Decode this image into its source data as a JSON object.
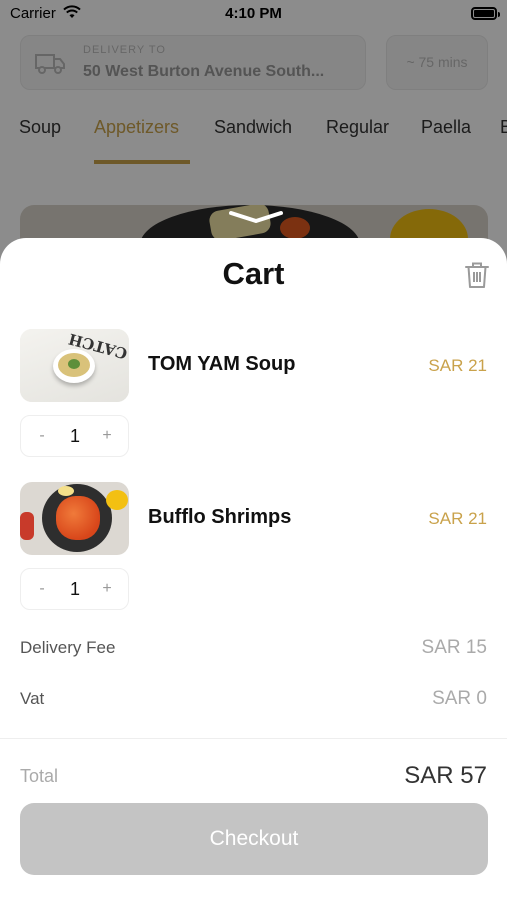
{
  "status_bar": {
    "carrier": "Carrier",
    "time": "4:10 PM"
  },
  "header": {
    "delivery_label": "DELIVERY TO",
    "delivery_address": "50 West Burton Avenue South...",
    "eta": "~ 75 mins"
  },
  "category_tabs": [
    {
      "label": "Soup",
      "active": false
    },
    {
      "label": "Appetizers",
      "active": true
    },
    {
      "label": "Sandwich",
      "active": false
    },
    {
      "label": "Regular",
      "active": false
    },
    {
      "label": "Paella",
      "active": false
    },
    {
      "label": "B",
      "active": false
    }
  ],
  "cart": {
    "title": "Cart",
    "items": [
      {
        "name": "TOM YAM Soup",
        "price": "SAR 21",
        "quantity": "1",
        "minus": "-",
        "plus": "+"
      },
      {
        "name": "Bufflo Shrimps",
        "price": "SAR 21",
        "quantity": "1",
        "minus": "-",
        "plus": "+"
      }
    ],
    "delivery_fee": {
      "label": "Delivery Fee",
      "value": "SAR 15"
    },
    "vat": {
      "label": "Vat",
      "value": "SAR 0"
    },
    "total": {
      "label": "Total",
      "value": "SAR 57"
    },
    "checkout_label": "Checkout",
    "photo_text": "CATCH"
  },
  "colors": {
    "accent": "#c9a24b",
    "checkout_disabled": "#c4c4c4",
    "overlay": "rgba(0,0,0,0.45)"
  },
  "icons": {
    "wifi": "wifi-icon",
    "battery": "battery-icon",
    "truck": "truck-icon",
    "trash": "trash-icon",
    "chevron": "chevron-down-icon"
  }
}
